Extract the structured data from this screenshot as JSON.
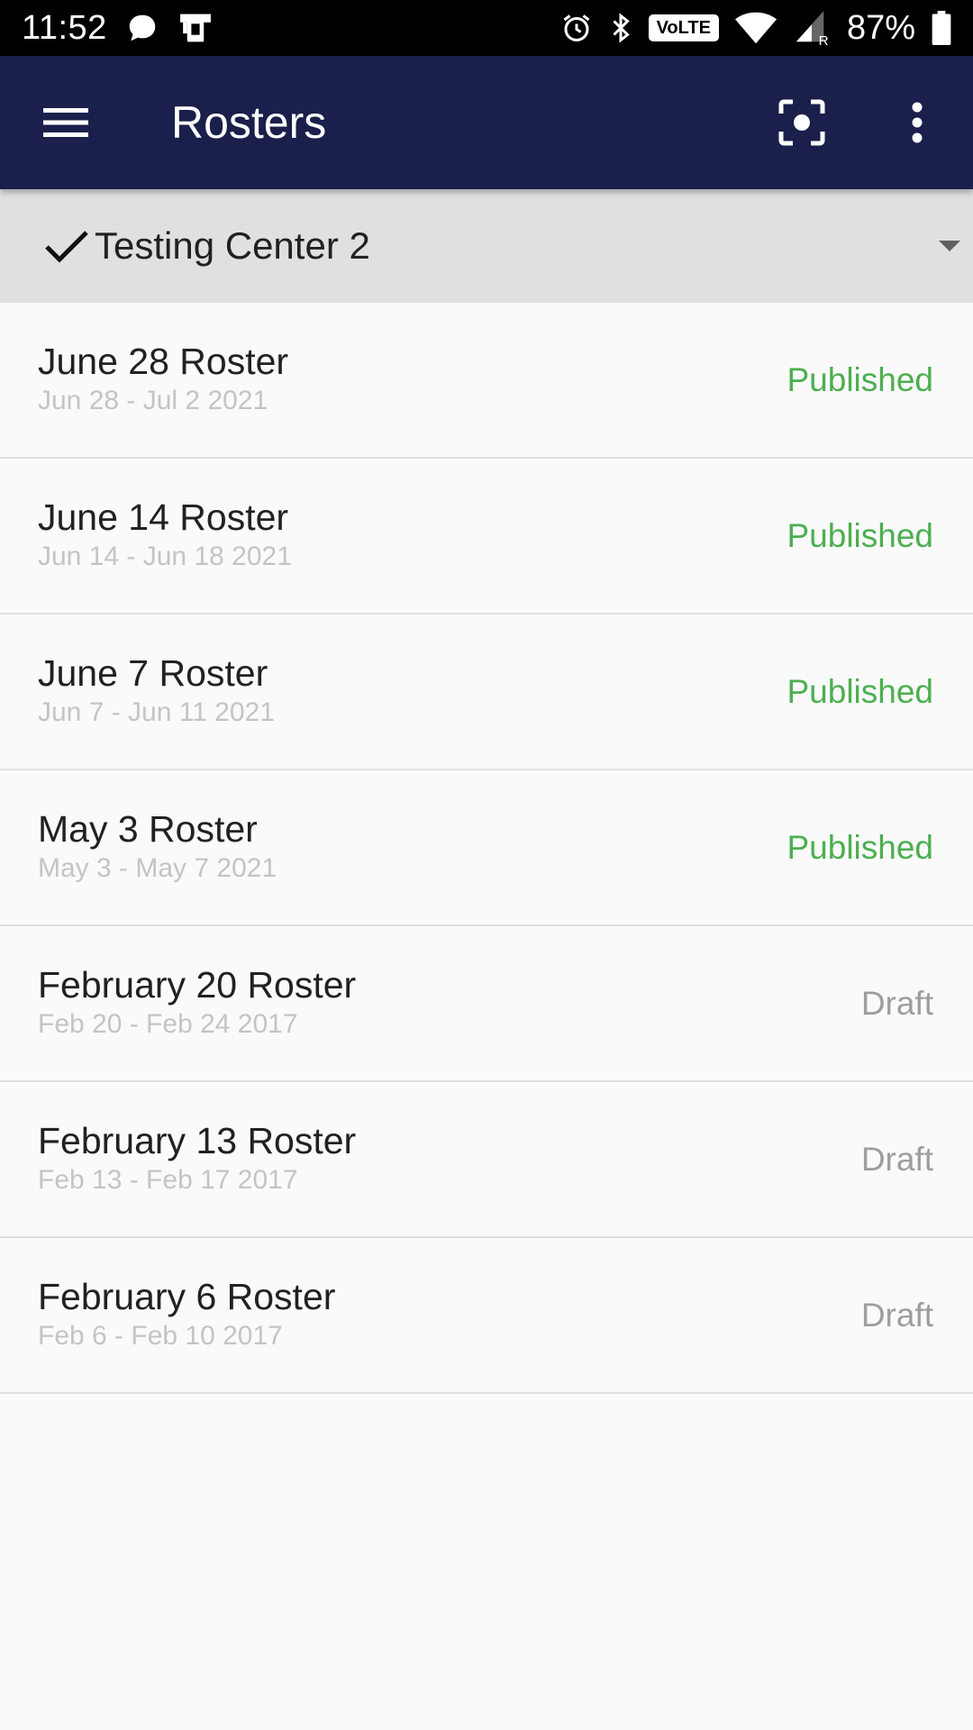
{
  "status_bar": {
    "time": "11:52",
    "icons_left": [
      "chat-bubble-icon",
      "device-notification-icon"
    ],
    "icons_right": [
      "alarm-icon",
      "bluetooth-icon",
      "volte-badge",
      "wifi-icon",
      "cell-signal-icon",
      "battery-icon"
    ],
    "volte_label": "VoLTE",
    "roaming_label": "R",
    "battery_percent": "87%"
  },
  "app_bar": {
    "title": "Rosters",
    "background_color": "#1a1f4b",
    "icons": [
      "menu-icon",
      "scan-icon",
      "more-vert-icon"
    ]
  },
  "center_selector": {
    "selected": "Testing Center 2",
    "icon": "check-icon"
  },
  "rosters": [
    {
      "name": "June 28 Roster",
      "dates": "Jun 28 - Jul 2 2021",
      "status": "Published"
    },
    {
      "name": "June 14 Roster",
      "dates": "Jun 14 - Jun 18 2021",
      "status": "Published"
    },
    {
      "name": "June 7 Roster",
      "dates": "Jun 7 - Jun 11 2021",
      "status": "Published"
    },
    {
      "name": "May 3 Roster",
      "dates": "May 3 - May 7 2021",
      "status": "Published"
    },
    {
      "name": "February 20 Roster",
      "dates": "Feb 20 - Feb 24 2017",
      "status": "Draft"
    },
    {
      "name": "February 13 Roster",
      "dates": "Feb 13 - Feb 17 2017",
      "status": "Draft"
    },
    {
      "name": "February 6 Roster",
      "dates": "Feb 6 - Feb 10 2017",
      "status": "Draft"
    }
  ],
  "colors": {
    "published": "#4caf50",
    "draft": "#9e9e9e",
    "status_bar": "#000000",
    "selector_background": "#e0e0e0"
  }
}
